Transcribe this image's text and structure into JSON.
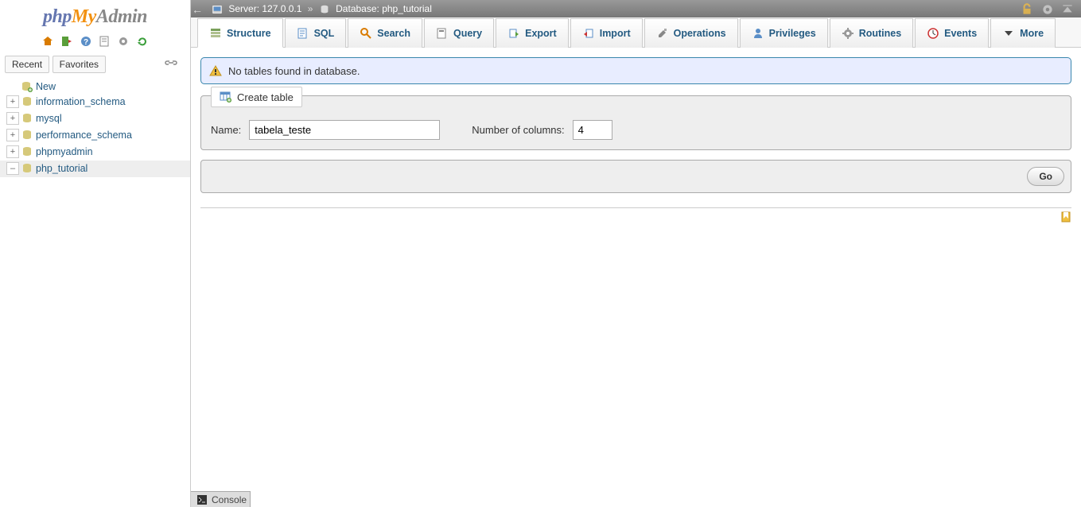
{
  "logo": {
    "php": "php",
    "my": "My",
    "admin": "Admin"
  },
  "side_tabs": {
    "recent": "Recent",
    "favorites": "Favorites"
  },
  "tree": {
    "new": "New",
    "items": [
      {
        "label": "information_schema"
      },
      {
        "label": "mysql"
      },
      {
        "label": "performance_schema"
      },
      {
        "label": "phpmyadmin"
      },
      {
        "label": "php_tutorial"
      }
    ]
  },
  "breadcrumb": {
    "server_label": "Server:",
    "server_value": "127.0.0.1",
    "database_label": "Database:",
    "database_value": "php_tutorial",
    "sep": "»"
  },
  "tabs": [
    {
      "label": "Structure"
    },
    {
      "label": "SQL"
    },
    {
      "label": "Search"
    },
    {
      "label": "Query"
    },
    {
      "label": "Export"
    },
    {
      "label": "Import"
    },
    {
      "label": "Operations"
    },
    {
      "label": "Privileges"
    },
    {
      "label": "Routines"
    },
    {
      "label": "Events"
    },
    {
      "label": "More"
    }
  ],
  "notice": "No tables found in database.",
  "create": {
    "legend": "Create table",
    "name_label": "Name:",
    "name_value": "tabela_teste",
    "cols_label": "Number of columns:",
    "cols_value": "4",
    "go": "Go"
  },
  "console": "Console"
}
